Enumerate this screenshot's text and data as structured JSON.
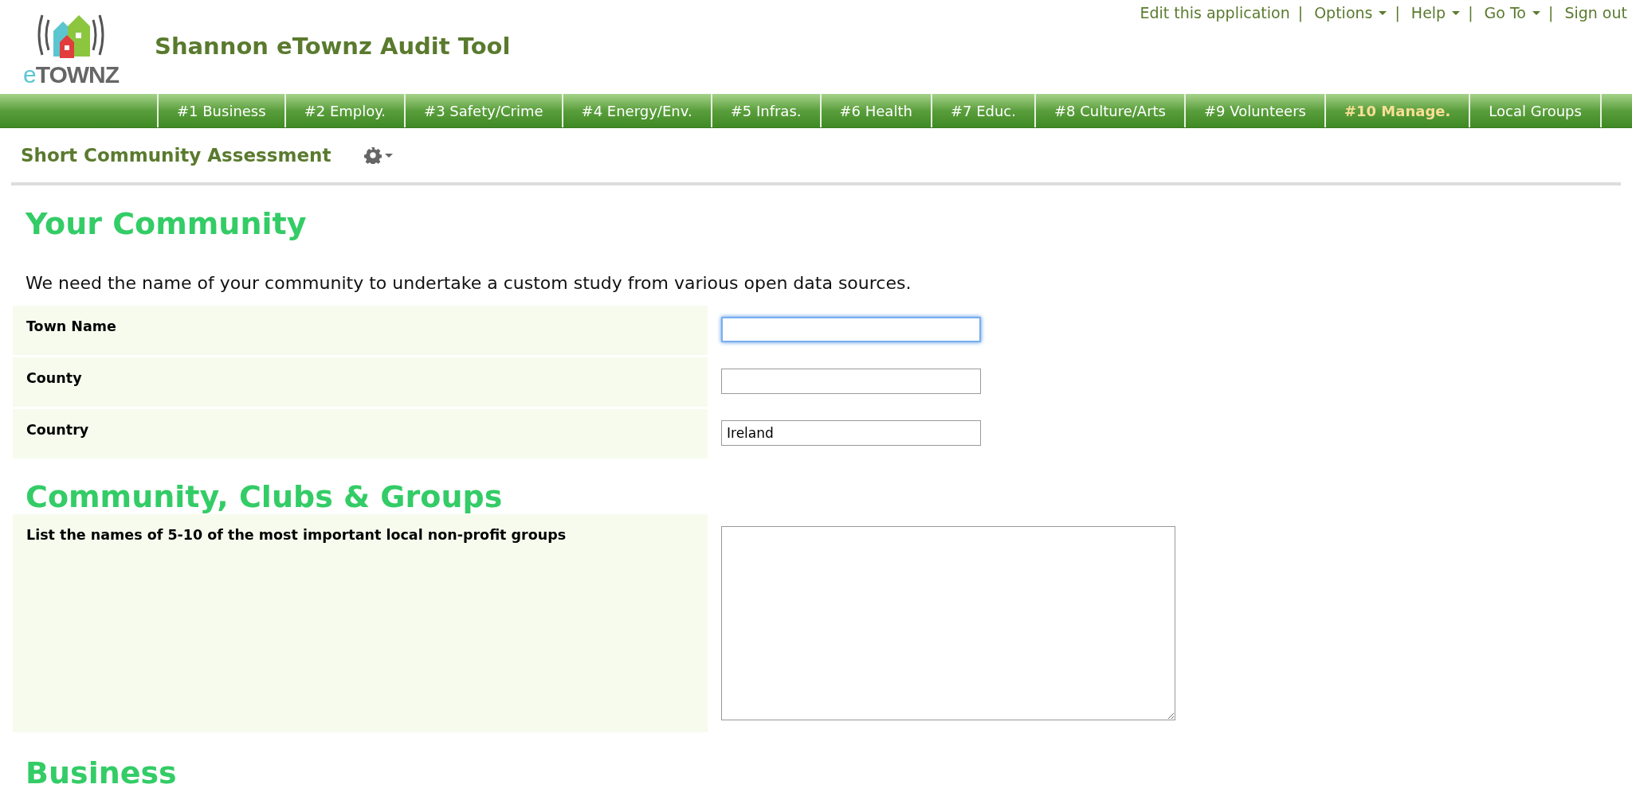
{
  "logo": {
    "prefix": "e",
    "main": "TOWNZ"
  },
  "app_title": "Shannon eTownz Audit Tool",
  "top_link_separator": "|",
  "top_links": [
    {
      "label": "Edit this application",
      "dropdown": false
    },
    {
      "label": "Options",
      "dropdown": true
    },
    {
      "label": "Help",
      "dropdown": true
    },
    {
      "label": "Go To",
      "dropdown": true
    },
    {
      "label": "Sign out",
      "dropdown": false
    }
  ],
  "nav_tabs": [
    {
      "label": "#1 Business",
      "selected": false
    },
    {
      "label": "#2 Employ.",
      "selected": false
    },
    {
      "label": "#3 Safety/Crime",
      "selected": false
    },
    {
      "label": "#4 Energy/Env.",
      "selected": false
    },
    {
      "label": "#5 Infras.",
      "selected": false
    },
    {
      "label": "#6 Health",
      "selected": false
    },
    {
      "label": "#7 Educ.",
      "selected": false
    },
    {
      "label": "#8 Culture/Arts",
      "selected": false
    },
    {
      "label": "#9 Volunteers",
      "selected": false
    },
    {
      "label": "#10 Manage.",
      "selected": true
    },
    {
      "label": "Local Groups",
      "selected": false
    }
  ],
  "page_title": "Short Community Assessment",
  "sections": [
    {
      "heading": "Your Community",
      "intro": "We need the name of your community to undertake a custom study from various open data sources.",
      "fields": [
        {
          "label": "Town Name",
          "kind": "text",
          "focused": true
        },
        {
          "label": "County",
          "kind": "text",
          "focused": false
        },
        {
          "label": "Country",
          "kind": "text",
          "value": "Ireland",
          "focused": false
        }
      ]
    },
    {
      "heading": "Community, Clubs & Groups",
      "fields": [
        {
          "label": "List the names of 5-10 of the most important local non-profit groups",
          "kind": "textarea",
          "focused": false
        }
      ]
    },
    {
      "heading": "Business"
    }
  ]
}
